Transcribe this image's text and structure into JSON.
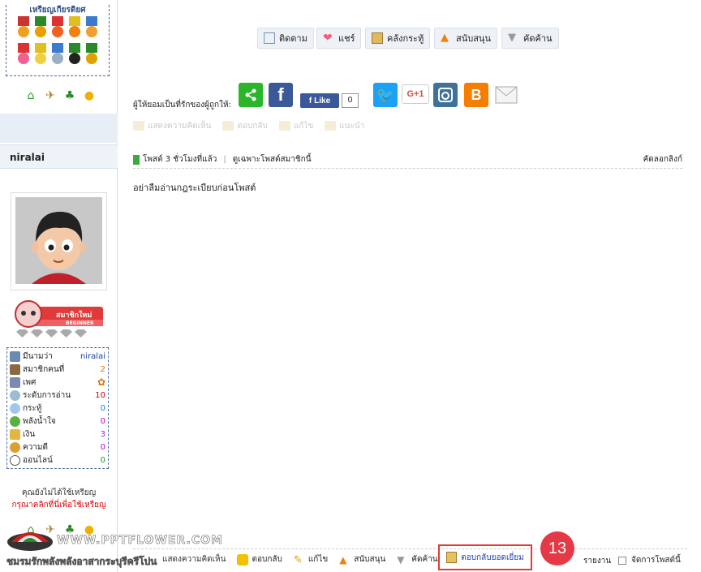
{
  "sidebar": {
    "medal_title": "เหรียญเกียรติยศ",
    "side_note": "คุณยังไม่ได้ใช้เหรียญ",
    "side_link": "กรุณาคลิกที่นี่เพื่อใช้เหรียญ",
    "username": "niralai",
    "rank_label": "สมาชิกใหม่",
    "rank_sub": "BEGINNER",
    "stats": [
      {
        "label": "มีนามว่า",
        "value": "niralai",
        "color": "#1a3fa8"
      },
      {
        "label": "สมาชิกคนที่",
        "value": "2",
        "color": "#e07000"
      },
      {
        "label": "เพศ",
        "value": "",
        "color": "#e07000"
      },
      {
        "label": "ระดับการอ่าน",
        "value": "10",
        "color": "#d00000"
      },
      {
        "label": "กระทู้",
        "value": "0",
        "color": "#1a7fd0"
      },
      {
        "label": "พลังน้ำใจ",
        "value": "0",
        "color": "#d000d0"
      },
      {
        "label": "เงิน",
        "value": "3",
        "color": "#8a2be2"
      },
      {
        "label": "ความดี",
        "value": "0",
        "color": "#d000d0"
      },
      {
        "label": "ออนไลน์",
        "value": "0",
        "color": "#1a9a1a"
      }
    ]
  },
  "watermark": {
    "site": "WWW.PPTFLOWER.COM",
    "tagline": "ชมรมรักพลังพลังอาสากระบุรีครีโปน"
  },
  "top_actions": [
    {
      "label": "ติดตาม",
      "icon": "follow-icon"
    },
    {
      "label": "แชร์",
      "icon": "heart-icon"
    },
    {
      "label": "คลังกระทู้",
      "icon": "archive-icon"
    },
    {
      "label": "สนับสนุน",
      "icon": "arrow-up-icon"
    },
    {
      "label": "คัดค้าน",
      "icon": "arrow-down-icon"
    }
  ],
  "share": {
    "label": "ผู้ให้ยอมเป็นที่รักของผู้ถูกให้:",
    "fb_like": "Like",
    "fb_count": "0",
    "gplus": "G+1"
  },
  "faded_actions": [
    "แสดงความคิดเห็น",
    "ตอบกลับ",
    "แก้ไข",
    "แนะนำ"
  ],
  "post": {
    "meta_time": "โพสต์ 3 ชั่วโมงที่แล้ว",
    "meta_filter": "ดูเฉพาะโพสต์สมาชิกนี้",
    "copy_link": "คัดลอกลิงก์",
    "body": "อย่าลืมอ่านกฎระเบียบก่อนโพสต์"
  },
  "bottom_actions": {
    "comment": "แสดงความคิดเห็น",
    "reply": "ตอบกลับ",
    "edit": "แก้ไข",
    "support": "สนับสนุน",
    "oppose": "คัดค้าน",
    "best_reply": "ตอบกลับยอดเยี่ยม",
    "step": "13",
    "report": "รายงาน",
    "manage": "จัดการโพสต์นี้"
  },
  "colors": {
    "accent_red": "#e53935",
    "facebook": "#3b5998",
    "twitter": "#1da1f2",
    "share_green": "#2bb52b"
  }
}
